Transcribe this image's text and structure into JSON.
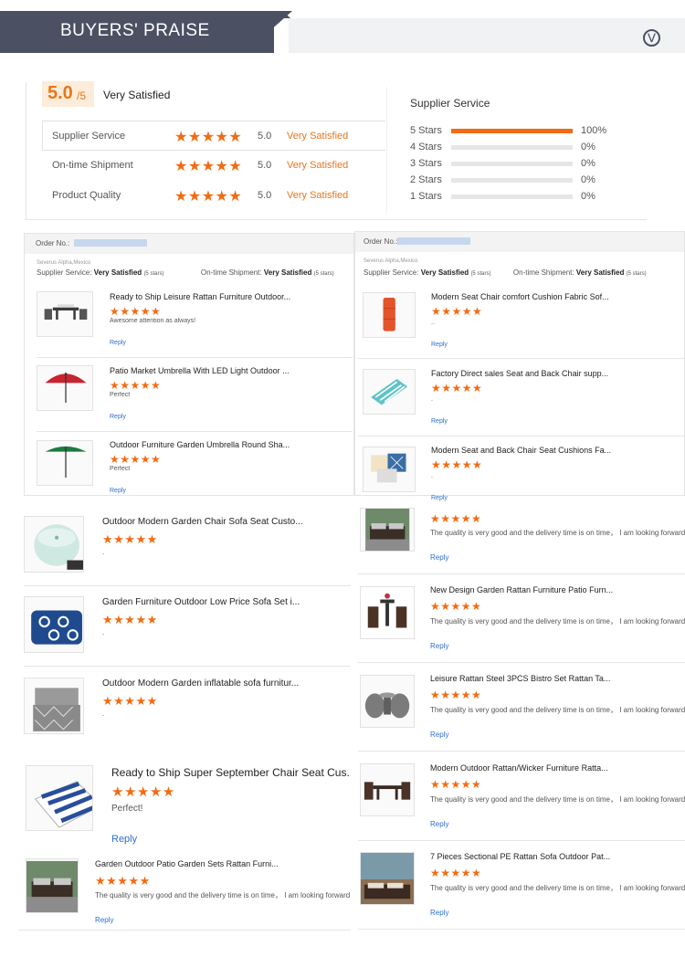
{
  "header": {
    "title": "BUYERS' PRAISE",
    "toggle_icon": "chevron-down-circle-icon"
  },
  "summary": {
    "score": "5.0",
    "score_suffix": "/5",
    "label": "Very Satisfied",
    "ratings": [
      {
        "label": "Supplier Service",
        "stars": "★★★★★",
        "value": "5.0",
        "satisfaction": "Very Satisfied"
      },
      {
        "label": "On-time Shipment",
        "stars": "★★★★★",
        "value": "5.0",
        "satisfaction": "Very Satisfied"
      },
      {
        "label": "Product Quality",
        "stars": "★★★★★",
        "value": "5.0",
        "satisfaction": "Very Satisfied"
      }
    ],
    "supplier_service_title": "Supplier Service",
    "distribution": [
      {
        "label": "5 Stars",
        "percent": 100,
        "text": "100%"
      },
      {
        "label": "4 Stars",
        "percent": 0,
        "text": "0%"
      },
      {
        "label": "3 Stars",
        "percent": 0,
        "text": "0%"
      },
      {
        "label": "2 Stars",
        "percent": 0,
        "text": "0%"
      },
      {
        "label": "1 Stars",
        "percent": 0,
        "text": "0%"
      }
    ]
  },
  "orders": [
    {
      "order_label": "Order No.:",
      "buyer": "Severus Alpha,Mexico",
      "supplier_label": "Supplier Service:",
      "supplier_value": "Very Satisfied",
      "supplier_count": "(5 stars)",
      "shipment_label": "On-time Shipment:",
      "shipment_value": "Very Satisfied",
      "shipment_count": "(5 stars)"
    },
    {
      "order_label": "Order No.:",
      "buyer": "Severus Alpha,Mexico",
      "supplier_label": "Supplier Service:",
      "supplier_value": "Very Satisfied",
      "supplier_count": "(5 stars)",
      "shipment_label": "On-time Shipment:",
      "shipment_value": "Very Satisfied",
      "shipment_count": "(5 stars)"
    }
  ],
  "reviews_left": [
    {
      "title": "Ready to Ship Leisure Rattan Furniture Outdoor...",
      "stars": "★★★★★",
      "comment": "Awesome attention as always!",
      "reply": "Reply",
      "image": "rattan-table-set-icon"
    },
    {
      "title": "Patio Market Umbrella With LED Light Outdoor ...",
      "stars": "★★★★★",
      "comment": "Perfect",
      "reply": "Reply",
      "image": "red-umbrella-icon"
    },
    {
      "title": "Outdoor Furniture Garden Umbrella Round Sha...",
      "stars": "★★★★★",
      "comment": "Perfect",
      "reply": "Reply",
      "image": "green-umbrella-icon"
    },
    {
      "title": "Outdoor Modern Garden Chair Sofa Seat Custo...",
      "stars": "★★★★★",
      "comment": ".",
      "reply": "",
      "image": "round-pouf-icon"
    },
    {
      "title": "Garden Furniture Outdoor Low Price Sofa Set i...",
      "stars": "★★★★★",
      "comment": ".",
      "reply": "",
      "image": "blue-cushion-icon"
    },
    {
      "title": "Outdoor Modern Garden inflatable sofa furnitur...",
      "stars": "★★★★★",
      "comment": ".",
      "reply": "",
      "image": "inflatable-sofa-icon"
    },
    {
      "title": "Ready to Ship Super September Chair Seat Cus...",
      "stars": "★★★★★",
      "comment": "Perfect!",
      "reply": "Reply",
      "image": "striped-cushion-icon"
    },
    {
      "title": "Garden Outdoor Patio Garden Sets Rattan Furni...",
      "stars": "★★★★★",
      "comment": "The quality is very good and the delivery time is on time， I am looking forward to the next cooperation",
      "reply": "Reply",
      "image": "rattan-sofa-set-icon"
    }
  ],
  "reviews_right": [
    {
      "title": "Modern Seat Chair comfort Cushion Fabric Sof...",
      "stars": "★★★★★",
      "comment": "..",
      "reply": "Reply",
      "image": "orange-lounger-icon"
    },
    {
      "title": "Factory Direct sales Seat and Back Chair supp...",
      "stars": "★★★★★",
      "comment": ".",
      "reply": "Reply",
      "image": "bolster-pillow-icon"
    },
    {
      "title": "Modern Seat and Back Chair Seat Cushions Fa...",
      "stars": "★★★★★",
      "comment": ".",
      "reply": "Reply",
      "image": "throw-pillows-icon"
    },
    {
      "title": "",
      "stars": "★★★★★",
      "comment": "The quality is very good and the delivery time is on time， I am looking forward to the next cooperation",
      "reply": "Reply",
      "image": "rattan-sofa-set-icon"
    },
    {
      "title": "New Design Garden Rattan Furniture Patio Furn...",
      "stars": "★★★★★",
      "comment": "The quality is very good and the delivery time is on time， I am looking forward to the next cooperation",
      "reply": "Reply",
      "image": "bar-set-icon"
    },
    {
      "title": "Leisure Rattan Steel 3PCS Bistro Set Rattan Ta...",
      "stars": "★★★★★",
      "comment": "The quality is very good and the delivery time is on time， I am looking forward to the next cooperation",
      "reply": "Reply",
      "image": "bistro-set-icon"
    },
    {
      "title": "Modern Outdoor Rattan/Wicker Furniture Ratta...",
      "stars": "★★★★★",
      "comment": "The quality is very good and the delivery time is on time， I am looking forward to the next cooperation",
      "reply": "Reply",
      "image": "wicker-dining-icon"
    },
    {
      "title": "7 Pieces Sectional PE Rattan Sofa Outdoor Pat...",
      "stars": "★★★★★",
      "comment": "The quality is very good and the delivery time is on time， I am looking forward to the next cooperation",
      "reply": "Reply",
      "image": "sectional-sofa-icon"
    }
  ],
  "colors": {
    "accent": "#f26b13",
    "header_bg": "#4b5163",
    "link": "#2c6fcf"
  }
}
